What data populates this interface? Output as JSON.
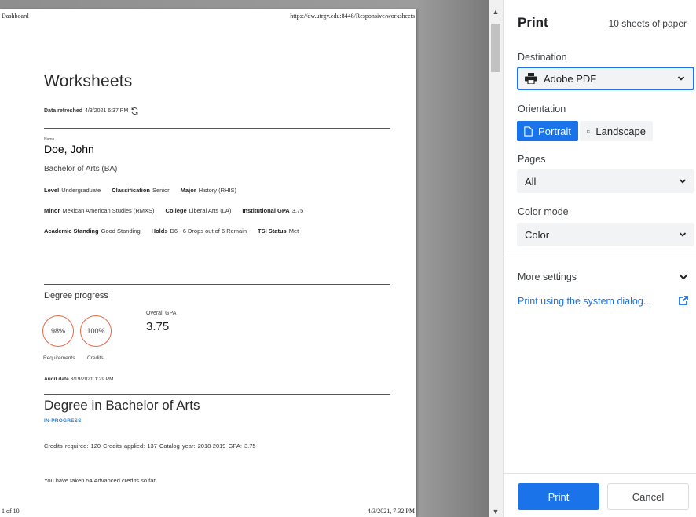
{
  "sheet": {
    "header_left": "Dashboard",
    "header_right": "https://dw.utrgv.edu:8448/Responsive/worksheets",
    "footer_left": "1 of 10",
    "footer_right": "4/3/2021, 7:32 PM",
    "title": "Worksheets",
    "data_refreshed_label": "Data refreshed",
    "data_refreshed_value": "4/3/2021 6:37 PM",
    "name_label": "Name",
    "name_value": "Doe, John",
    "degree": "Bachelor of Arts (BA)",
    "info": {
      "level_label": "Level",
      "level_value": "Undergraduate",
      "classification_label": "Classification",
      "classification_value": "Senior",
      "major_label": "Major",
      "major_value": "History (RHIS)",
      "minor_label": "Minor",
      "minor_value": "Mexican American Studies (RMXS)",
      "college_label": "College",
      "college_value": "Liberal Arts (LA)",
      "inst_gpa_label": "Institutional GPA",
      "inst_gpa_value": "3.75",
      "standing_label": "Academic Standing",
      "standing_value": "Good Standing",
      "holds_label": "Holds",
      "holds_value": "D6 - 6 Drops out of 6 Remain",
      "tsi_label": "TSI Status",
      "tsi_value": "Met"
    },
    "progress": {
      "title": "Degree progress",
      "requirements_pct": "98%",
      "credits_pct": "100%",
      "requirements_label": "Requirements",
      "credits_label": "Credits",
      "overall_gpa_label": "Overall GPA",
      "overall_gpa_value": "3.75"
    },
    "audit_label": "Audit date",
    "audit_value": "3/19/2021 1:29 PM",
    "degree_title": "Degree in Bachelor of Arts",
    "degree_status": "IN-PROGRESS",
    "credits_row": "Credits required:  120    Credits applied:  137    Catalog year:  2018-2019    GPA:  3.75",
    "advanced_note": "You have taken 54 Advanced credits so far."
  },
  "panel": {
    "title": "Print",
    "sheets": "10 sheets of paper",
    "destination_label": "Destination",
    "destination_value": "Adobe PDF",
    "orientation_label": "Orientation",
    "portrait_label": "Portrait",
    "landscape_label": "Landscape",
    "pages_label": "Pages",
    "pages_value": "All",
    "color_label": "Color mode",
    "color_value": "Color",
    "more_settings": "More settings",
    "system_dialog": "Print using the system dialog...",
    "print_button": "Print",
    "cancel_button": "Cancel"
  },
  "colors": {
    "accent": "#1a73e8",
    "ring": "#e56a47",
    "status": "#2f7fc1"
  },
  "icons": {
    "refresh": "refresh-icon",
    "printer": "printer-icon",
    "portrait": "portrait-page-icon",
    "landscape": "landscape-page-icon",
    "chevron": "chevron-down-icon",
    "external": "open-external-icon"
  }
}
